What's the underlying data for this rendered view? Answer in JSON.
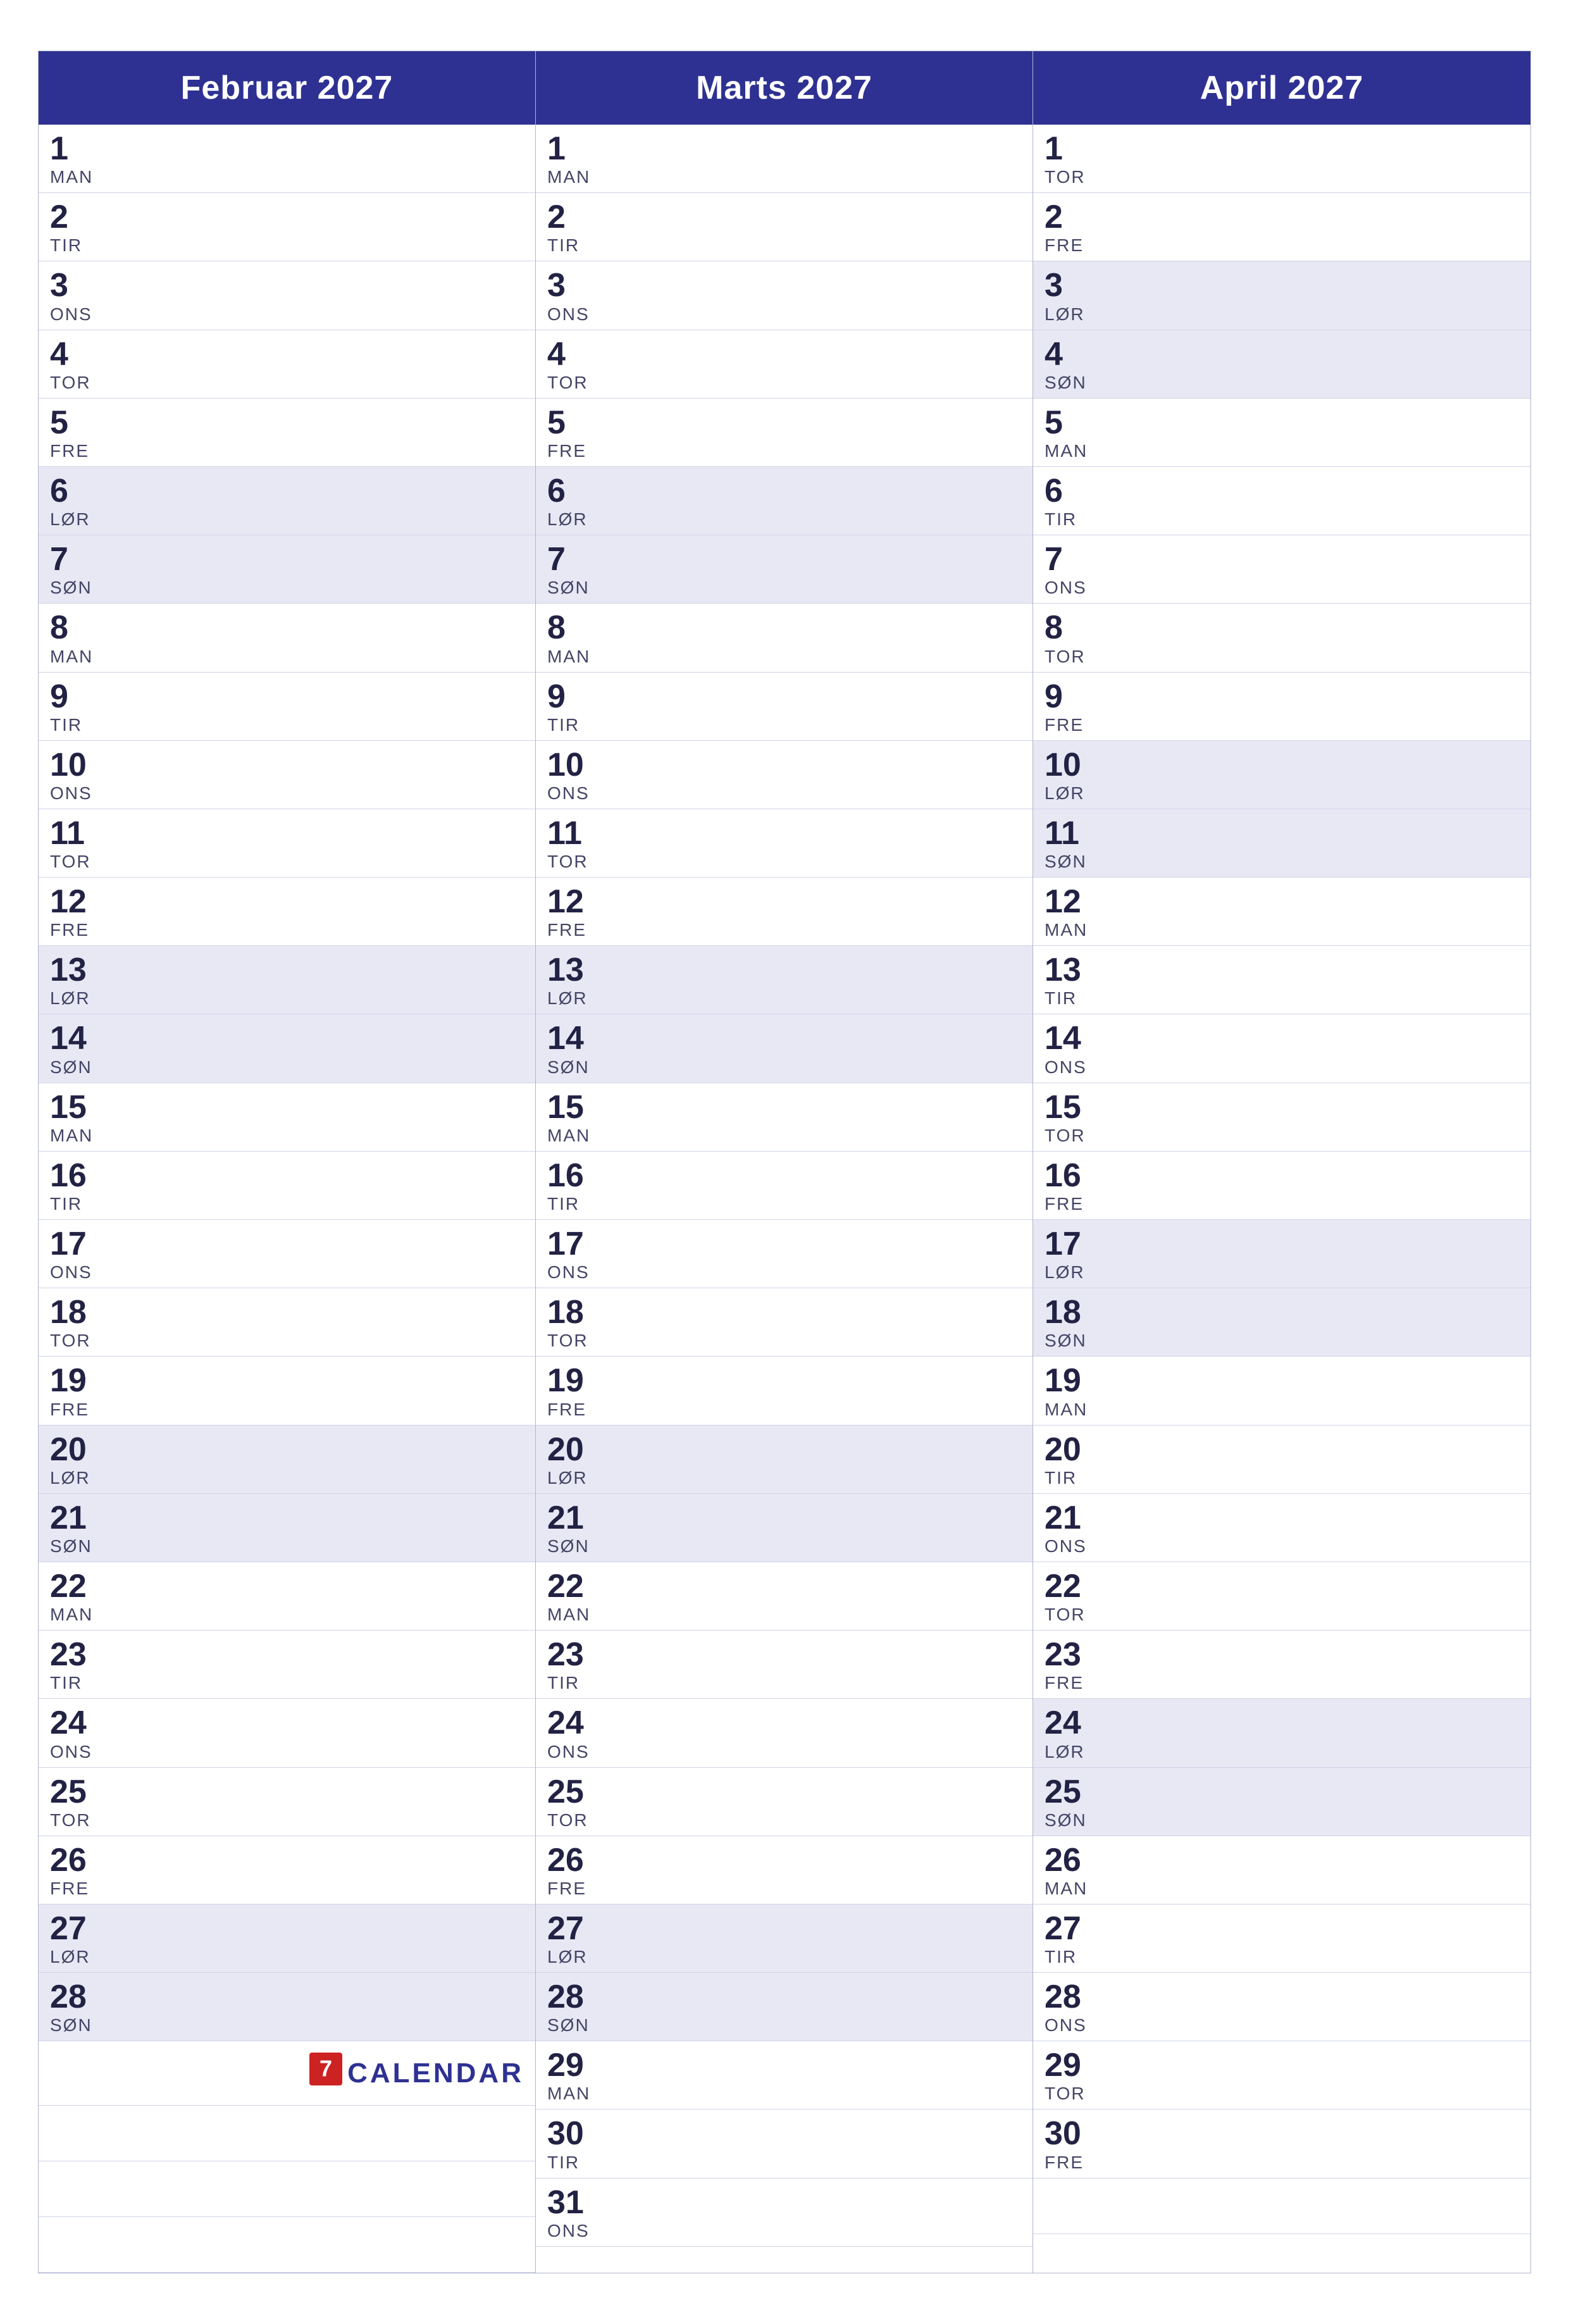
{
  "months": [
    {
      "name": "Februar 2027",
      "days": [
        {
          "num": "1",
          "day": "MAN",
          "weekend": false
        },
        {
          "num": "2",
          "day": "TIR",
          "weekend": false
        },
        {
          "num": "3",
          "day": "ONS",
          "weekend": false
        },
        {
          "num": "4",
          "day": "TOR",
          "weekend": false
        },
        {
          "num": "5",
          "day": "FRE",
          "weekend": false
        },
        {
          "num": "6",
          "day": "LØR",
          "weekend": true
        },
        {
          "num": "7",
          "day": "SØN",
          "weekend": true
        },
        {
          "num": "8",
          "day": "MAN",
          "weekend": false
        },
        {
          "num": "9",
          "day": "TIR",
          "weekend": false
        },
        {
          "num": "10",
          "day": "ONS",
          "weekend": false
        },
        {
          "num": "11",
          "day": "TOR",
          "weekend": false
        },
        {
          "num": "12",
          "day": "FRE",
          "weekend": false
        },
        {
          "num": "13",
          "day": "LØR",
          "weekend": true
        },
        {
          "num": "14",
          "day": "SØN",
          "weekend": true
        },
        {
          "num": "15",
          "day": "MAN",
          "weekend": false
        },
        {
          "num": "16",
          "day": "TIR",
          "weekend": false
        },
        {
          "num": "17",
          "day": "ONS",
          "weekend": false
        },
        {
          "num": "18",
          "day": "TOR",
          "weekend": false
        },
        {
          "num": "19",
          "day": "FRE",
          "weekend": false
        },
        {
          "num": "20",
          "day": "LØR",
          "weekend": true
        },
        {
          "num": "21",
          "day": "SØN",
          "weekend": true
        },
        {
          "num": "22",
          "day": "MAN",
          "weekend": false
        },
        {
          "num": "23",
          "day": "TIR",
          "weekend": false
        },
        {
          "num": "24",
          "day": "ONS",
          "weekend": false
        },
        {
          "num": "25",
          "day": "TOR",
          "weekend": false
        },
        {
          "num": "26",
          "day": "FRE",
          "weekend": false
        },
        {
          "num": "27",
          "day": "LØR",
          "weekend": true
        },
        {
          "num": "28",
          "day": "SØN",
          "weekend": true
        }
      ],
      "hasLogo": true,
      "extraFillers": 3
    },
    {
      "name": "Marts 2027",
      "days": [
        {
          "num": "1",
          "day": "MAN",
          "weekend": false
        },
        {
          "num": "2",
          "day": "TIR",
          "weekend": false
        },
        {
          "num": "3",
          "day": "ONS",
          "weekend": false
        },
        {
          "num": "4",
          "day": "TOR",
          "weekend": false
        },
        {
          "num": "5",
          "day": "FRE",
          "weekend": false
        },
        {
          "num": "6",
          "day": "LØR",
          "weekend": true
        },
        {
          "num": "7",
          "day": "SØN",
          "weekend": true
        },
        {
          "num": "8",
          "day": "MAN",
          "weekend": false
        },
        {
          "num": "9",
          "day": "TIR",
          "weekend": false
        },
        {
          "num": "10",
          "day": "ONS",
          "weekend": false
        },
        {
          "num": "11",
          "day": "TOR",
          "weekend": false
        },
        {
          "num": "12",
          "day": "FRE",
          "weekend": false
        },
        {
          "num": "13",
          "day": "LØR",
          "weekend": true
        },
        {
          "num": "14",
          "day": "SØN",
          "weekend": true
        },
        {
          "num": "15",
          "day": "MAN",
          "weekend": false
        },
        {
          "num": "16",
          "day": "TIR",
          "weekend": false
        },
        {
          "num": "17",
          "day": "ONS",
          "weekend": false
        },
        {
          "num": "18",
          "day": "TOR",
          "weekend": false
        },
        {
          "num": "19",
          "day": "FRE",
          "weekend": false
        },
        {
          "num": "20",
          "day": "LØR",
          "weekend": true
        },
        {
          "num": "21",
          "day": "SØN",
          "weekend": true
        },
        {
          "num": "22",
          "day": "MAN",
          "weekend": false
        },
        {
          "num": "23",
          "day": "TIR",
          "weekend": false
        },
        {
          "num": "24",
          "day": "ONS",
          "weekend": false
        },
        {
          "num": "25",
          "day": "TOR",
          "weekend": false
        },
        {
          "num": "26",
          "day": "FRE",
          "weekend": false
        },
        {
          "num": "27",
          "day": "LØR",
          "weekend": true
        },
        {
          "num": "28",
          "day": "SØN",
          "weekend": true
        },
        {
          "num": "29",
          "day": "MAN",
          "weekend": false
        },
        {
          "num": "30",
          "day": "TIR",
          "weekend": false
        },
        {
          "num": "31",
          "day": "ONS",
          "weekend": false
        }
      ],
      "hasLogo": false,
      "extraFillers": 0
    },
    {
      "name": "April 2027",
      "days": [
        {
          "num": "1",
          "day": "TOR",
          "weekend": false
        },
        {
          "num": "2",
          "day": "FRE",
          "weekend": false
        },
        {
          "num": "3",
          "day": "LØR",
          "weekend": true
        },
        {
          "num": "4",
          "day": "SØN",
          "weekend": true
        },
        {
          "num": "5",
          "day": "MAN",
          "weekend": false
        },
        {
          "num": "6",
          "day": "TIR",
          "weekend": false
        },
        {
          "num": "7",
          "day": "ONS",
          "weekend": false
        },
        {
          "num": "8",
          "day": "TOR",
          "weekend": false
        },
        {
          "num": "9",
          "day": "FRE",
          "weekend": false
        },
        {
          "num": "10",
          "day": "LØR",
          "weekend": true
        },
        {
          "num": "11",
          "day": "SØN",
          "weekend": true
        },
        {
          "num": "12",
          "day": "MAN",
          "weekend": false
        },
        {
          "num": "13",
          "day": "TIR",
          "weekend": false
        },
        {
          "num": "14",
          "day": "ONS",
          "weekend": false
        },
        {
          "num": "15",
          "day": "TOR",
          "weekend": false
        },
        {
          "num": "16",
          "day": "FRE",
          "weekend": false
        },
        {
          "num": "17",
          "day": "LØR",
          "weekend": true
        },
        {
          "num": "18",
          "day": "SØN",
          "weekend": true
        },
        {
          "num": "19",
          "day": "MAN",
          "weekend": false
        },
        {
          "num": "20",
          "day": "TIR",
          "weekend": false
        },
        {
          "num": "21",
          "day": "ONS",
          "weekend": false
        },
        {
          "num": "22",
          "day": "TOR",
          "weekend": false
        },
        {
          "num": "23",
          "day": "FRE",
          "weekend": false
        },
        {
          "num": "24",
          "day": "LØR",
          "weekend": true
        },
        {
          "num": "25",
          "day": "SØN",
          "weekend": true
        },
        {
          "num": "26",
          "day": "MAN",
          "weekend": false
        },
        {
          "num": "27",
          "day": "TIR",
          "weekend": false
        },
        {
          "num": "28",
          "day": "ONS",
          "weekend": false
        },
        {
          "num": "29",
          "day": "TOR",
          "weekend": false
        },
        {
          "num": "30",
          "day": "FRE",
          "weekend": false
        }
      ],
      "hasLogo": false,
      "extraFillers": 1
    }
  ],
  "logo": {
    "icon": "7",
    "text": "CALENDAR"
  }
}
